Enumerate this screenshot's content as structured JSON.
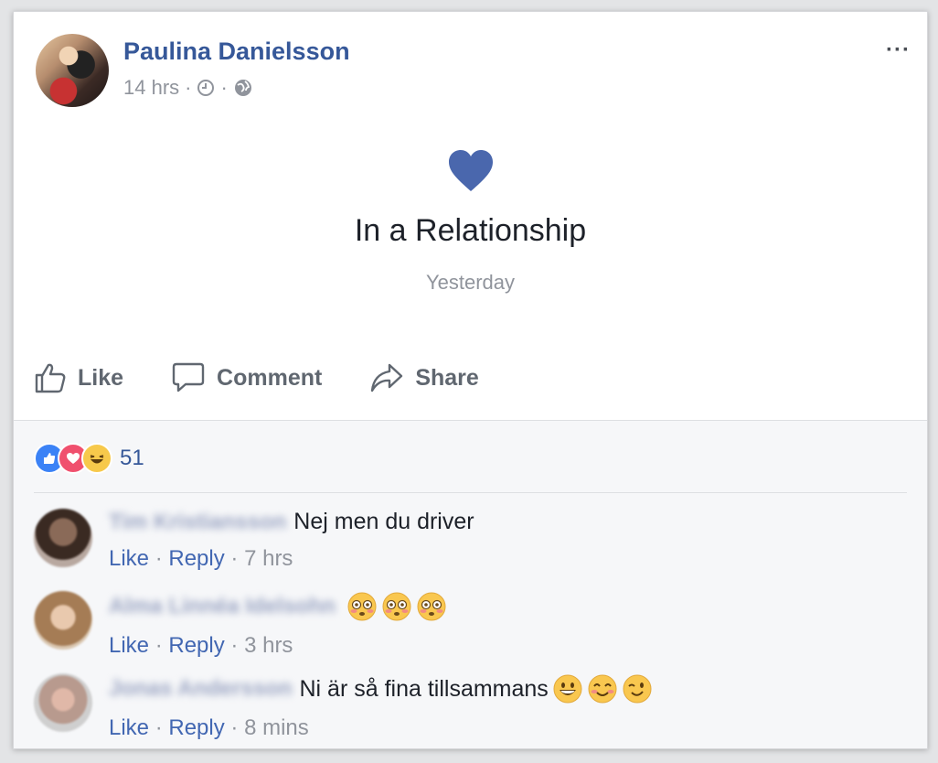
{
  "post": {
    "author": "Paulina Danielsson",
    "time": "14 hrs",
    "dot": "·",
    "more": "···"
  },
  "life_event": {
    "title": "In a Relationship",
    "date": "Yesterday",
    "icon": "heart-icon",
    "color": "#4a67ad"
  },
  "actions": {
    "like": "Like",
    "comment": "Comment",
    "share": "Share"
  },
  "reactions": {
    "count": "51",
    "types": [
      "like",
      "love",
      "haha"
    ]
  },
  "comments": [
    {
      "author": "Tim Kristiansson",
      "text": "Nej men du driver",
      "like": "Like",
      "reply": "Reply",
      "time": "7 hrs",
      "emojis": []
    },
    {
      "author": "Alma Linnéa Idelsohn",
      "text": "",
      "like": "Like",
      "reply": "Reply",
      "time": "3 hrs",
      "emojis": [
        "flushed",
        "flushed",
        "flushed"
      ]
    },
    {
      "author": "Jonas Andersson",
      "text": "Ni är så fina tillsammans",
      "like": "Like",
      "reply": "Reply",
      "time": "8 mins",
      "emojis": [
        "grinning",
        "blush",
        "wink"
      ]
    }
  ],
  "colors": {
    "link": "#365899",
    "muted": "#90949c",
    "background": "#f6f7f9"
  }
}
